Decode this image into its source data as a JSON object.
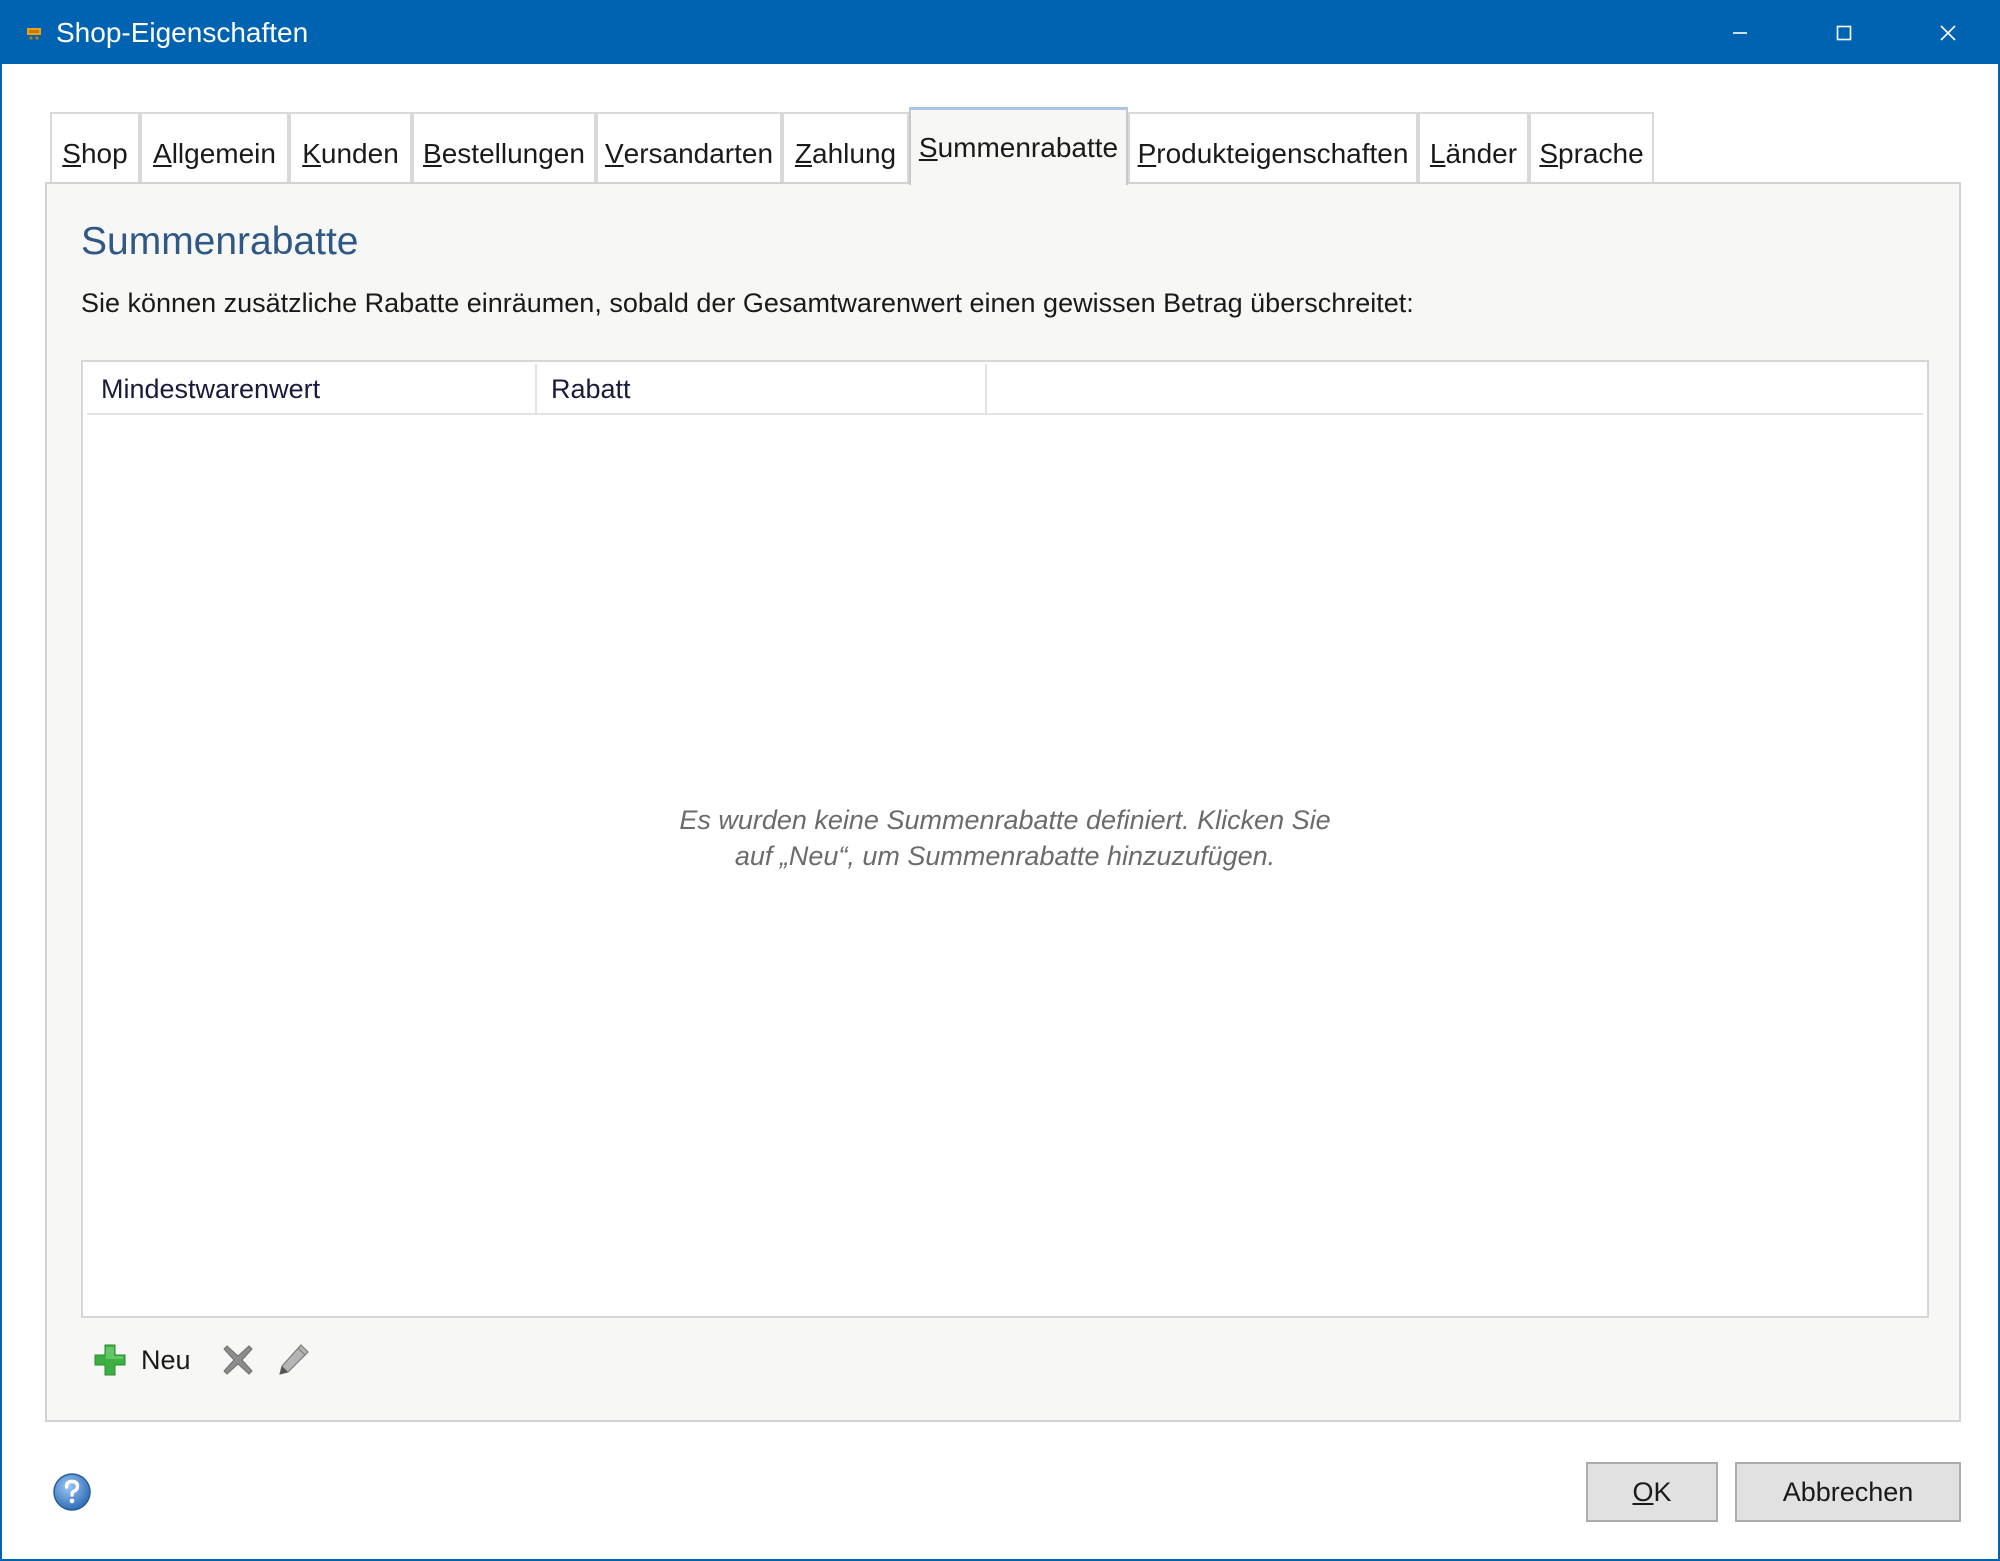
{
  "window": {
    "title": "Shop-Eigenschaften"
  },
  "tabs": [
    {
      "key": "S",
      "rest": "hop"
    },
    {
      "key": "A",
      "rest": "llgemein"
    },
    {
      "key": "K",
      "rest": "unden"
    },
    {
      "key": "B",
      "rest": "estellungen"
    },
    {
      "key": "V",
      "rest": "ersandarten"
    },
    {
      "key": "Z",
      "rest": "ahlung"
    },
    {
      "key": "S",
      "rest": "ummenrabatte"
    },
    {
      "key": "P",
      "rest": "rodukteigenschaften"
    },
    {
      "key": "L",
      "rest": "änder"
    },
    {
      "key": "S",
      "rest": "prache"
    }
  ],
  "active_tab_index": 6,
  "panel": {
    "title": "Summenrabatte",
    "description": "Sie können zusätzliche Rabatte einräumen, sobald der Gesamtwarenwert einen gewissen Betrag überschreitet:",
    "columns": [
      "Mindestwarenwert",
      "Rabatt"
    ],
    "empty_line1": "Es wurden keine Summenrabatte definiert. Klicken Sie",
    "empty_line2": "auf „Neu“, um Summenrabatte hinzuzufügen.",
    "new_label": "Neu"
  },
  "buttons": {
    "ok_key": "O",
    "ok_rest": "K",
    "cancel": "Abbrechen"
  },
  "colors": {
    "titlebar": "#0063b1",
    "section_title": "#2f5885",
    "add_icon": "#3cb043"
  },
  "icons": [
    "shop-cart-icon",
    "minimize-icon",
    "maximize-icon",
    "close-icon",
    "add-icon",
    "delete-icon",
    "edit-pencil-icon",
    "help-icon"
  ]
}
